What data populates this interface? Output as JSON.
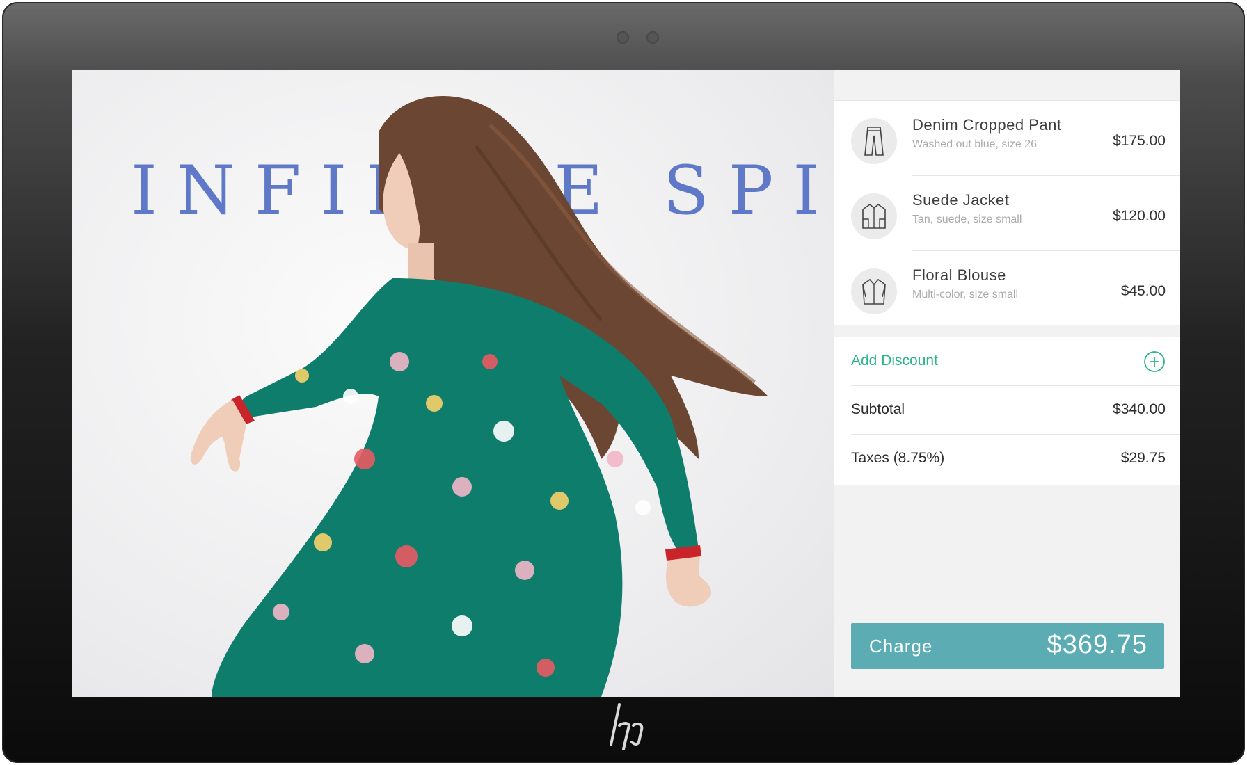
{
  "hero": {
    "title": "INFINITE SPIRIT"
  },
  "cart": {
    "items": [
      {
        "name": "Denim Cropped Pant",
        "description": "Washed out blue, size 26",
        "price": "$175.00",
        "icon": "pants-icon"
      },
      {
        "name": "Suede Jacket",
        "description": "Tan, suede, size small",
        "price": "$120.00",
        "icon": "jacket-icon"
      },
      {
        "name": "Floral Blouse",
        "description": "Multi-color, size small",
        "price": "$45.00",
        "icon": "blouse-icon"
      }
    ],
    "discount_label": "Add Discount",
    "subtotal_label": "Subtotal",
    "subtotal_value": "$340.00",
    "taxes_label": "Taxes (8.75%)",
    "taxes_value": "$29.75",
    "charge_label": "Charge",
    "charge_total": "$369.75"
  },
  "colors": {
    "accent_green": "#2db48a",
    "charge_button": "#5badb3",
    "hero_title": "#5f79c8"
  }
}
